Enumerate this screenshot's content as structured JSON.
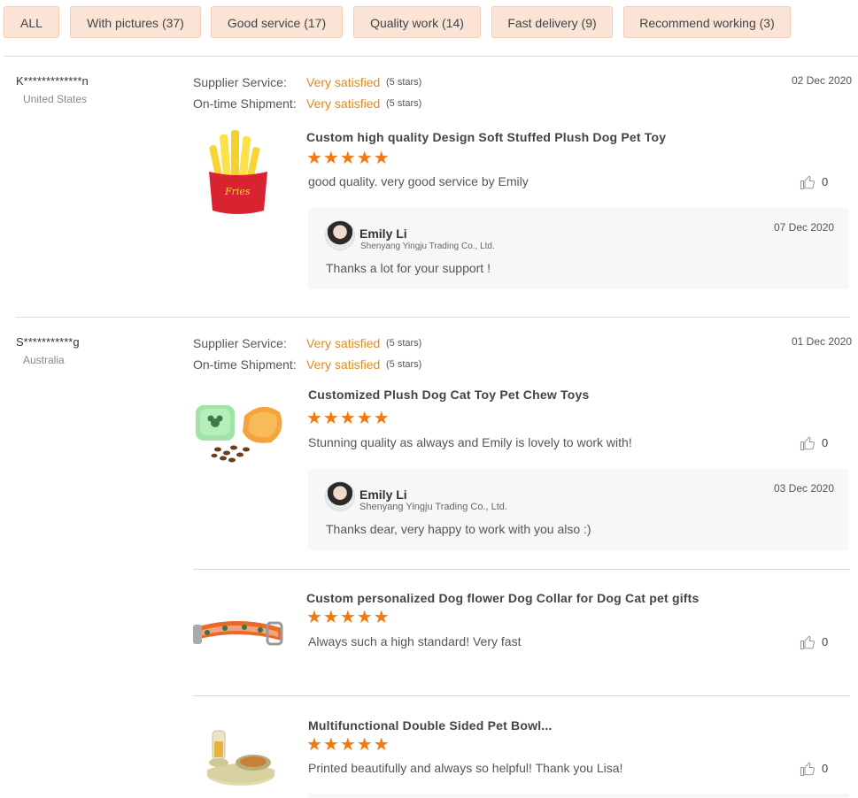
{
  "filters": [
    {
      "label": "ALL"
    },
    {
      "label": "With pictures (37)"
    },
    {
      "label": "Good service (17)"
    },
    {
      "label": "Quality work (14)"
    },
    {
      "label": "Fast delivery (9)"
    },
    {
      "label": "Recommend working (3)"
    }
  ],
  "review_labels": {
    "supplier_service": "Supplier Service:",
    "ontime_shipment": "On-time Shipment:",
    "satisfied": "Very satisfied",
    "five_stars": "(5 stars)",
    "star_glyphs": "★★★★★"
  },
  "reviews": [
    {
      "buyer": "K*************n",
      "country": "United States",
      "date": "02 Dec 2020",
      "items": [
        {
          "product": "Custom high quality Design Soft Stuffed Plush Dog Pet Toy",
          "rating": 5,
          "comment": "good quality. very good service by  Emily",
          "likes": "0",
          "image_label": "Fries",
          "reply": {
            "name": "Emily Li",
            "company": "Shenyang Yingju Trading Co., Ltd.",
            "date": "07 Dec 2020",
            "text": "Thanks a lot for your support !"
          }
        }
      ]
    },
    {
      "buyer": "S***********g",
      "country": "Australia",
      "date": "01 Dec 2020",
      "items": [
        {
          "product": "Customized Plush Dog Cat Toy Pet Chew Toys",
          "rating": 5,
          "comment": "Stunning quality as always and  Emily is  lovely to work with!",
          "likes": "0",
          "reply": {
            "name": "Emily Li",
            "company": "Shenyang Yingju Trading Co., Ltd.",
            "date": "03 Dec 2020",
            "text": "Thanks dear, very happy to work with you also :)"
          }
        },
        {
          "product": "Custom personalized Dog flower Dog Collar for Dog Cat pet gifts",
          "rating": 5,
          "comment": "Always such a high standard! Very fast",
          "likes": "0"
        },
        {
          "product": "Multifunctional Double Sided Pet Bowl...",
          "rating": 5,
          "comment": "Printed beautifully and always so helpful! Thank you Lisa!",
          "likes": "0"
        }
      ]
    }
  ],
  "colors": {
    "accent": "#f07a10",
    "satisfied": "#e08a1e",
    "chip_bg": "#fbe3d6"
  },
  "icons": {
    "like": "thumbs-up-icon"
  }
}
